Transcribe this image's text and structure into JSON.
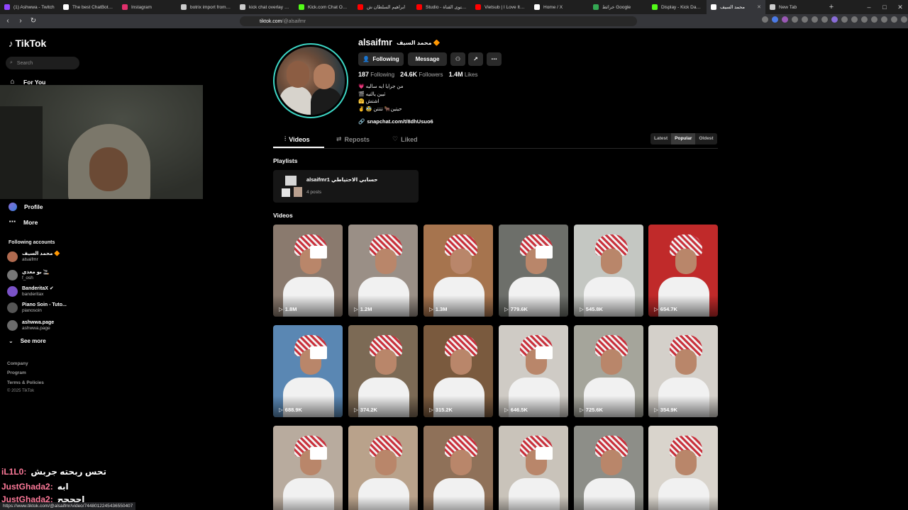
{
  "browser": {
    "tabs": [
      {
        "title": "(1) Ashwwa - Twitch",
        "color": "#9146ff",
        "active": false
      },
      {
        "title": "The best ChatBot and",
        "color": "#ffffff",
        "active": false
      },
      {
        "title": "Instagram",
        "color": "#e1306c",
        "active": false
      },
      {
        "title": "botrix import from str",
        "color": "#cccccc",
        "active": false
      },
      {
        "title": "kick chat overlay - بحث",
        "color": "#cccccc",
        "active": false
      },
      {
        "title": "Kick.com Chat Overlay",
        "color": "#53fc18",
        "active": false
      },
      {
        "title": "ابراهيم السلطان ش",
        "color": "#ff0000",
        "active": false
      },
      {
        "title": "Studio - محتوى القناة",
        "color": "#ff0000",
        "active": false
      },
      {
        "title": "Vietsub | I Love It - Ic",
        "color": "#ff0000",
        "active": false
      },
      {
        "title": "Home / X",
        "color": "#ffffff",
        "active": false
      },
      {
        "title": "خرائط Google",
        "color": "#34a853",
        "active": false
      },
      {
        "title": "Display - Kick Dashbo",
        "color": "#53fc18",
        "active": false
      },
      {
        "title": "محمد السيف",
        "color": "#ffffff",
        "active": true
      },
      {
        "title": "New Tab",
        "color": "#cccccc",
        "active": false
      }
    ],
    "url_host": "tiktok.com",
    "url_path": "/@alsaifmr"
  },
  "sidebar": {
    "logo": "TikTok",
    "search_placeholder": "Search",
    "for_you": "For You",
    "profile": "Profile",
    "more": "More",
    "following_title": "Following accounts",
    "accounts": [
      {
        "name": "محمد السيف 🔶",
        "handle": "alsaifmr",
        "color": "#b06a4f"
      },
      {
        "name": "بو معذي 🚬",
        "handle": "f_osh",
        "color": "#777777"
      },
      {
        "name": "BanderitaX ✔",
        "handle": "banderitax",
        "color": "#7a52c7"
      },
      {
        "name": "Piano Soin - Tuto...",
        "handle": "pianosoin",
        "color": "#555555"
      },
      {
        "name": "ashwwa.page",
        "handle": "ashwwa.page",
        "color": "#6b6b6b"
      }
    ],
    "see_more": "See more",
    "footer": [
      "Company",
      "Program",
      "Terms & Policies"
    ],
    "copyright": "© 2025 TikTok"
  },
  "chat": [
    {
      "user": "iL1L0:",
      "msg": "تحس ربحته جربش"
    },
    {
      "user": "JustGhada2:",
      "msg": "ابه"
    },
    {
      "user": "JustGhada2:",
      "msg": "احححح"
    }
  ],
  "status_url": "https://www.tiktok.com/@alsaifmr/video/7448012245436550407",
  "profile": {
    "username": "alsaifmr",
    "display_name": "محمد السيف 🔶",
    "following_btn": "Following",
    "message_btn": "Message",
    "following_count": "187",
    "following_label": "Following",
    "followers_count": "24.6K",
    "followers_label": "Followers",
    "likes_count": "1.4M",
    "likes_label": "Likes",
    "bio": [
      "💗 من جرايا ايه ساليه",
      "🎬 ثيين يالتيه",
      "🤗 اشتش",
      "✌️ 🥸 حيتين🐂 تتتتن"
    ],
    "link": "snapchat.com/t/8dhUsuo6"
  },
  "tabs": {
    "videos": "Videos",
    "reposts": "Reposts",
    "liked": "Liked"
  },
  "sort": {
    "latest": "Latest",
    "popular": "Popular",
    "oldest": "Oldest"
  },
  "playlists_title": "Playlists",
  "playlist": {
    "title": "alsaifmr1 حسابي الاحتياطي",
    "count": "4 posts"
  },
  "videos_title": "Videos",
  "videos": [
    {
      "views": "1.8M",
      "bg": "#8a7a6e"
    },
    {
      "views": "1.2M",
      "bg": "#9a8f86"
    },
    {
      "views": "1.3M",
      "bg": "#a6744e"
    },
    {
      "views": "779.6K",
      "bg": "#6d6f6a"
    },
    {
      "views": "545.8K",
      "bg": "#c4c7c2"
    },
    {
      "views": "654.7K",
      "bg": "#c02a2a"
    },
    {
      "views": "688.9K",
      "bg": "#5a87b3"
    },
    {
      "views": "374.2K",
      "bg": "#7c6a55"
    },
    {
      "views": "315.2K",
      "bg": "#7a5a3e"
    },
    {
      "views": "646.5K",
      "bg": "#cfcbc5"
    },
    {
      "views": "725.6K",
      "bg": "#a5a59b"
    },
    {
      "views": "354.9K",
      "bg": "#d4d0ca"
    },
    {
      "views": "",
      "bg": "#b8ab9e"
    },
    {
      "views": "",
      "bg": "#b9a28b"
    },
    {
      "views": "",
      "bg": "#8f7159"
    },
    {
      "views": "",
      "bg": "#c9c3ba"
    },
    {
      "views": "",
      "bg": "#8d8e88"
    },
    {
      "views": "",
      "bg": "#d9d4cc"
    }
  ]
}
